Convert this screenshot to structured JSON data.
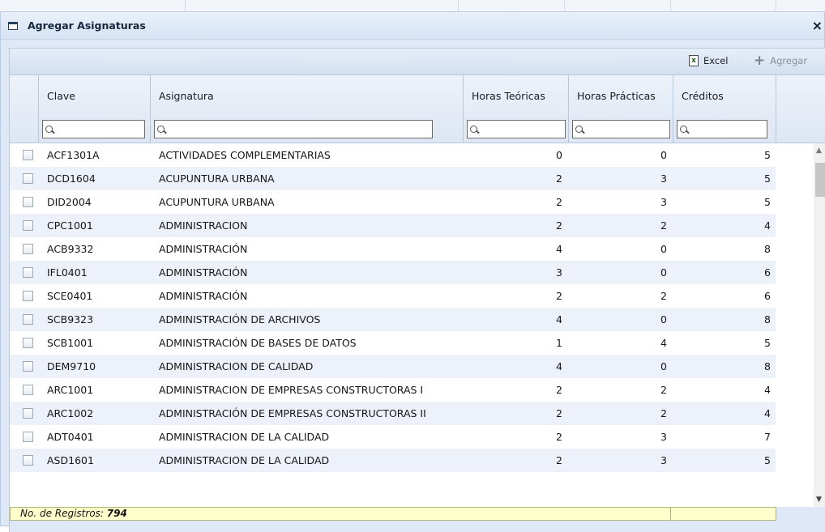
{
  "window": {
    "title": "Agregar Asignaturas",
    "close_glyph": "×"
  },
  "toolbar": {
    "excel_label": "Excel",
    "agregar_label": "Agregar"
  },
  "columns": [
    {
      "key": "clave",
      "label": "Clave"
    },
    {
      "key": "asignatura",
      "label": "Asignatura"
    },
    {
      "key": "ht",
      "label": "Horas Teóricas"
    },
    {
      "key": "hp",
      "label": "Horas Prácticas"
    },
    {
      "key": "cr",
      "label": "Créditos"
    }
  ],
  "rows": [
    {
      "clave": "ACF1301A",
      "asignatura": "ACTIVIDADES COMPLEMENTARIAS",
      "ht": "0",
      "hp": "0",
      "cr": "5"
    },
    {
      "clave": "DCD1604",
      "asignatura": "ACUPUNTURA URBANA",
      "ht": "2",
      "hp": "3",
      "cr": "5"
    },
    {
      "clave": "DID2004",
      "asignatura": "ACUPUNTURA URBANA",
      "ht": "2",
      "hp": "3",
      "cr": "5"
    },
    {
      "clave": "CPC1001",
      "asignatura": "ADMINISTRACION",
      "ht": "2",
      "hp": "2",
      "cr": "4"
    },
    {
      "clave": "ACB9332",
      "asignatura": "ADMINISTRACIÓN",
      "ht": "4",
      "hp": "0",
      "cr": "8"
    },
    {
      "clave": "IFL0401",
      "asignatura": "ADMINISTRACIÓN",
      "ht": "3",
      "hp": "0",
      "cr": "6"
    },
    {
      "clave": "SCE0401",
      "asignatura": "ADMINISTRACIÓN",
      "ht": "2",
      "hp": "2",
      "cr": "6"
    },
    {
      "clave": "SCB9323",
      "asignatura": "ADMINISTRACIÓN DE ARCHIVOS",
      "ht": "4",
      "hp": "0",
      "cr": "8"
    },
    {
      "clave": "SCB1001",
      "asignatura": "ADMINISTRACIÓN DE BASES DE DATOS",
      "ht": "1",
      "hp": "4",
      "cr": "5"
    },
    {
      "clave": "DEM9710",
      "asignatura": "ADMINISTRACION DE CALIDAD",
      "ht": "4",
      "hp": "0",
      "cr": "8"
    },
    {
      "clave": "ARC1001",
      "asignatura": "ADMINISTRACION DE EMPRESAS CONSTRUCTORAS I",
      "ht": "2",
      "hp": "2",
      "cr": "4"
    },
    {
      "clave": "ARC1002",
      "asignatura": "ADMINISTRACIÓN DE EMPRESAS CONSTRUCTORAS II",
      "ht": "2",
      "hp": "2",
      "cr": "4"
    },
    {
      "clave": "ADT0401",
      "asignatura": "ADMINISTRACION DE LA CALIDAD",
      "ht": "2",
      "hp": "3",
      "cr": "7"
    },
    {
      "clave": "ASD1601",
      "asignatura": "ADMINISTRACION DE LA CALIDAD",
      "ht": "2",
      "hp": "3",
      "cr": "5"
    }
  ],
  "footer": {
    "records_label": "No. de Registros:",
    "records_count": "794"
  }
}
